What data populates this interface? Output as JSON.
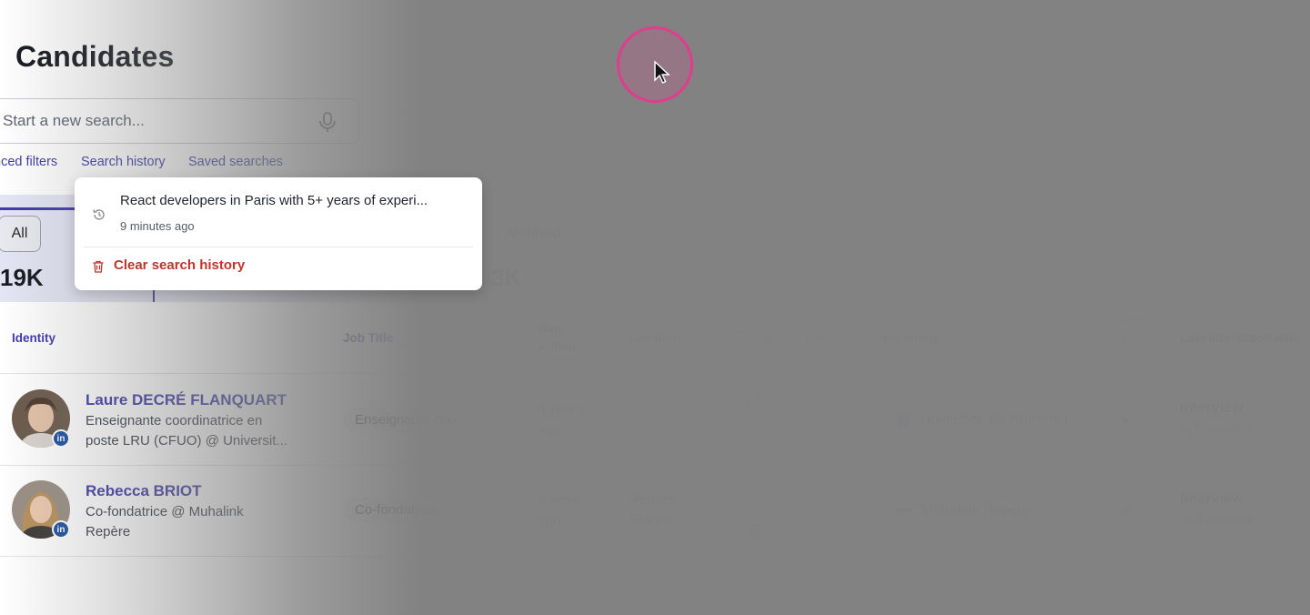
{
  "page": {
    "title": "Candidates"
  },
  "search": {
    "placeholder": "Start a new search..."
  },
  "links": {
    "advanced_filters": "Advanced filters",
    "search_history": "Search history",
    "saved_searches": "Saved searches"
  },
  "tabs": {
    "all": {
      "label": "All",
      "count": "19K"
    },
    "archived": {
      "label": "Archived",
      "count": "3K"
    }
  },
  "table": {
    "headers": {
      "identity": "Identity",
      "job_title": "Job Title",
      "date_added_1": "Date",
      "date_added_2": "Added",
      "location": "Location",
      "emails": "Emails",
      "phones": "Phones",
      "company": "Company",
      "open_to_work_1": "Open",
      "open_to_work_2": "to",
      "open_to_work_3": "work",
      "last_interaction": "Last interaction date"
    },
    "rows": [
      {
        "name": "Laure DECRÉ FLANQUART",
        "headline_1": "Enseignante coordinatrice en",
        "headline_2": "poste LRU (CFUO) @ Universit...",
        "job_title": "Enseignante coo...",
        "date_added_1": "4 years",
        "date_added_2": "ago",
        "location_1": "",
        "location_2": "",
        "company": "Université de Rennes I",
        "interaction_type": "Interview",
        "interaction_when": "in 6 months"
      },
      {
        "name": "Rebecca BRIOT",
        "headline_1": "Co-fondatrice @ Muhalink",
        "headline_2": "Repère",
        "job_title": "Co-fondatrice",
        "date_added_1": "2 years",
        "date_added_2": "ago",
        "location_1": "Rennes,",
        "location_2": "France",
        "company": "Muhalink Repère",
        "interaction_type": "Interview",
        "interaction_when": "in 4 months"
      }
    ]
  },
  "history_popover": {
    "query": "React developers in Paris with 5+ years of experi...",
    "time": "9 minutes ago",
    "clear_label": "Clear search history"
  },
  "colors": {
    "accent": "#3f3aa8",
    "danger": "#c0352b",
    "cursor_ring": "#e13c8d"
  }
}
